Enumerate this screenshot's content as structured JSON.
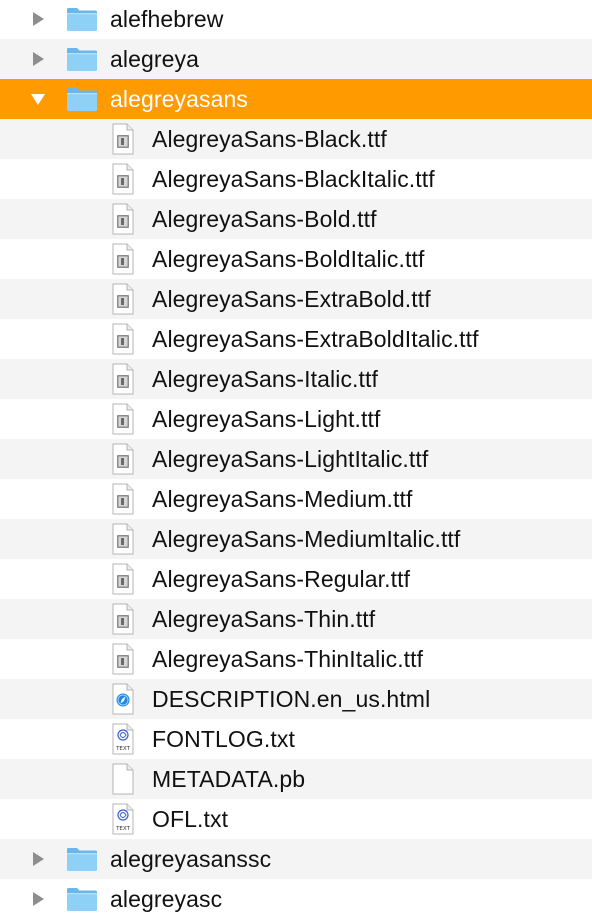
{
  "colors": {
    "selection": "#ff9a00",
    "alt_row": "#f4f4f4",
    "folder": "#7ac3f2",
    "disclosure": "#8e8e8e"
  },
  "items": [
    {
      "name": "alefhebrew",
      "kind": "folder",
      "expanded": false,
      "selected": false,
      "icon": "folder-icon"
    },
    {
      "name": "alegreya",
      "kind": "folder",
      "expanded": false,
      "selected": false,
      "icon": "folder-icon"
    },
    {
      "name": "alegreyasans",
      "kind": "folder",
      "expanded": true,
      "selected": true,
      "icon": "folder-icon"
    },
    {
      "name": "AlegreyaSans-Black.ttf",
      "kind": "file",
      "icon": "font-file-icon"
    },
    {
      "name": "AlegreyaSans-BlackItalic.ttf",
      "kind": "file",
      "icon": "font-file-icon"
    },
    {
      "name": "AlegreyaSans-Bold.ttf",
      "kind": "file",
      "icon": "font-file-icon"
    },
    {
      "name": "AlegreyaSans-BoldItalic.ttf",
      "kind": "file",
      "icon": "font-file-icon"
    },
    {
      "name": "AlegreyaSans-ExtraBold.ttf",
      "kind": "file",
      "icon": "font-file-icon"
    },
    {
      "name": "AlegreyaSans-ExtraBoldItalic.ttf",
      "kind": "file",
      "icon": "font-file-icon"
    },
    {
      "name": "AlegreyaSans-Italic.ttf",
      "kind": "file",
      "icon": "font-file-icon"
    },
    {
      "name": "AlegreyaSans-Light.ttf",
      "kind": "file",
      "icon": "font-file-icon"
    },
    {
      "name": "AlegreyaSans-LightItalic.ttf",
      "kind": "file",
      "icon": "font-file-icon"
    },
    {
      "name": "AlegreyaSans-Medium.ttf",
      "kind": "file",
      "icon": "font-file-icon"
    },
    {
      "name": "AlegreyaSans-MediumItalic.ttf",
      "kind": "file",
      "icon": "font-file-icon"
    },
    {
      "name": "AlegreyaSans-Regular.ttf",
      "kind": "file",
      "icon": "font-file-icon"
    },
    {
      "name": "AlegreyaSans-Thin.ttf",
      "kind": "file",
      "icon": "font-file-icon"
    },
    {
      "name": "AlegreyaSans-ThinItalic.ttf",
      "kind": "file",
      "icon": "font-file-icon"
    },
    {
      "name": "DESCRIPTION.en_us.html",
      "kind": "file",
      "icon": "html-file-icon"
    },
    {
      "name": "FONTLOG.txt",
      "kind": "file",
      "icon": "text-file-icon",
      "icon_label": "TEXT"
    },
    {
      "name": "METADATA.pb",
      "kind": "file",
      "icon": "blank-file-icon"
    },
    {
      "name": "OFL.txt",
      "kind": "file",
      "icon": "text-file-icon",
      "icon_label": "TEXT"
    },
    {
      "name": "alegreyasanssc",
      "kind": "folder",
      "expanded": false,
      "selected": false,
      "icon": "folder-icon"
    },
    {
      "name": "alegreyasc",
      "kind": "folder",
      "expanded": false,
      "selected": false,
      "icon": "folder-icon"
    }
  ]
}
